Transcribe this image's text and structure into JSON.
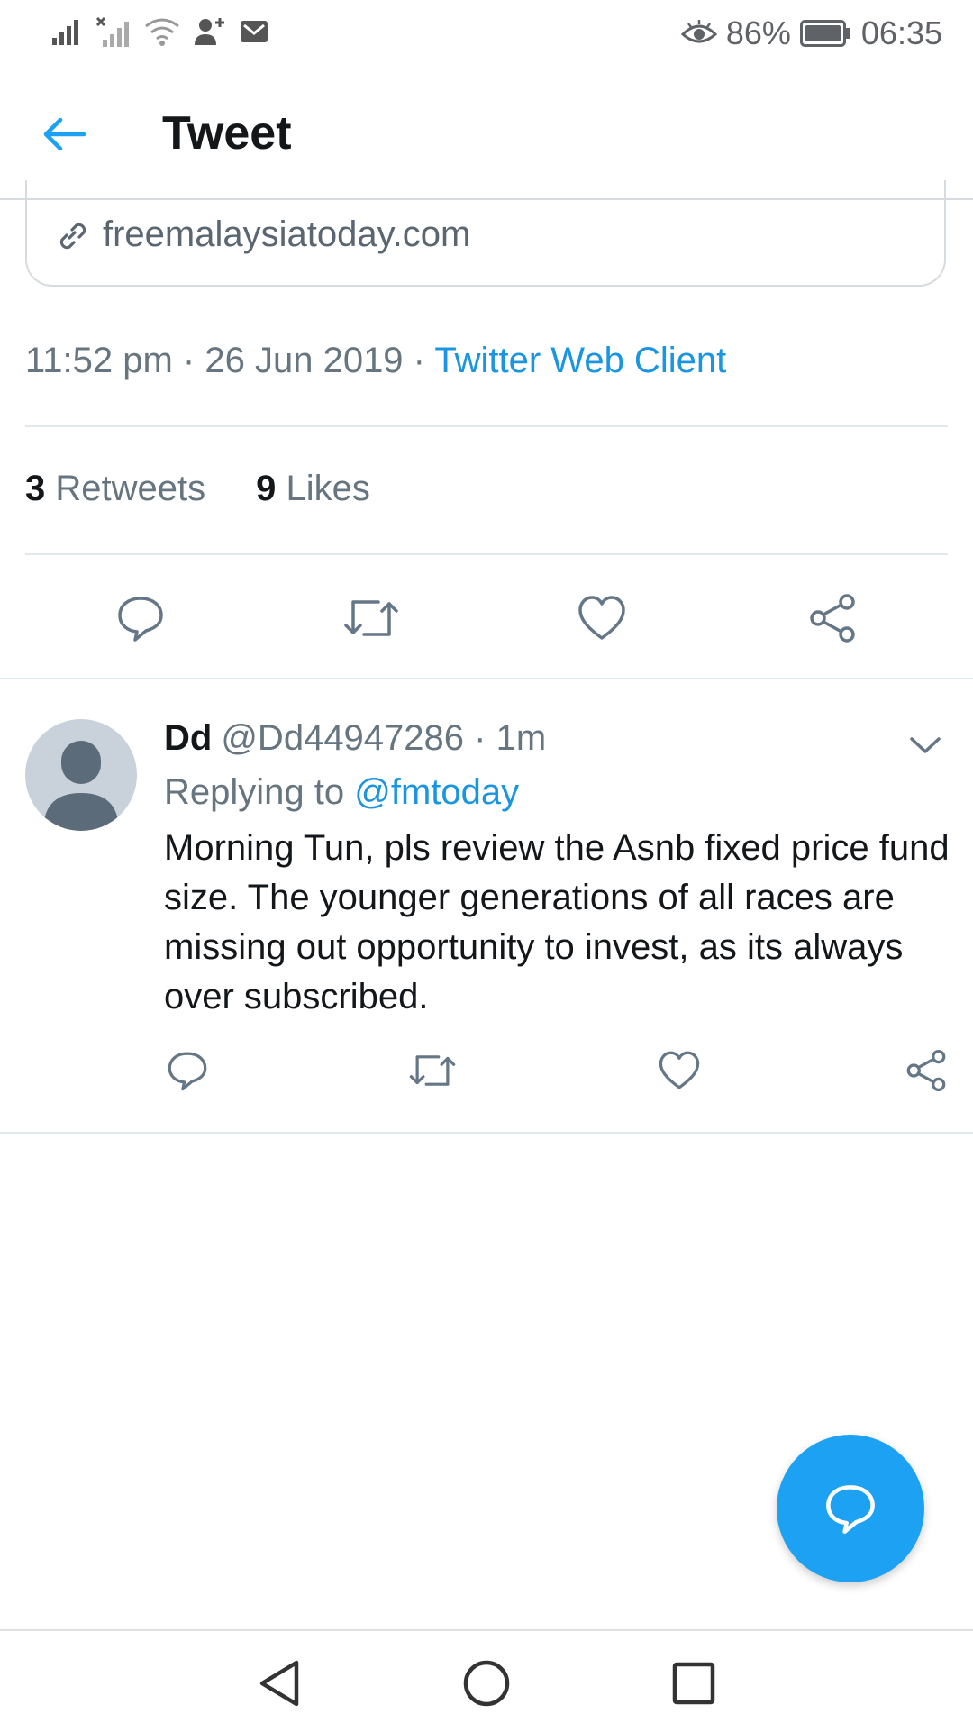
{
  "status_bar": {
    "battery": "86%",
    "time": "06:35"
  },
  "header": {
    "title": "Tweet"
  },
  "link_card": {
    "domain": "freemalaysiatoday.com"
  },
  "tweet_meta": {
    "time": "11:52 pm",
    "separator": " · ",
    "date": "26 Jun 2019",
    "client": "Twitter Web Client"
  },
  "stats": {
    "retweets_count": "3",
    "retweets_label": "Retweets",
    "likes_count": "9",
    "likes_label": "Likes"
  },
  "reply": {
    "name": "Dd",
    "handle": "@Dd44947286",
    "time": "· 1m",
    "replying_prefix": "Replying to",
    "replying_to": "@fmtoday",
    "text": "Morning Tun, pls review the Asnb fixed price fund size. The younger generations of all races are missing out opportunity to invest, as its always over subscribed."
  },
  "colors": {
    "accent": "#1da1f2",
    "link": "#1b95e0",
    "muted": "#66757f"
  },
  "icons": [
    "back-arrow-icon",
    "link-icon",
    "reply-icon",
    "retweet-icon",
    "like-icon",
    "share-icon",
    "chevron-down-icon",
    "compose-reply-icon",
    "nav-back-icon",
    "nav-home-icon",
    "nav-recents-icon"
  ]
}
